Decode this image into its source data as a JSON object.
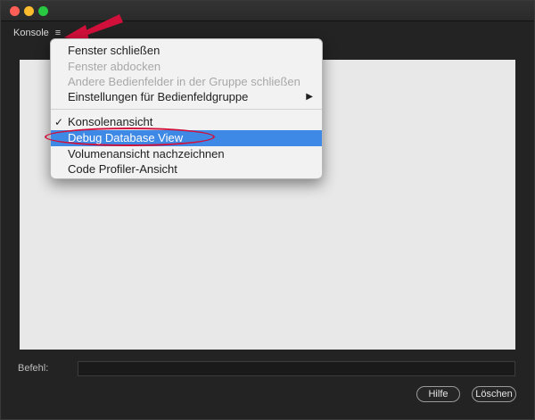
{
  "panel": {
    "title": "Konsole",
    "menu_icon": "hamburger-icon"
  },
  "menu": {
    "items": [
      {
        "label": "Fenster schließen"
      },
      {
        "label": "Fenster abdocken"
      },
      {
        "label": "Andere Bedienfelder in der Gruppe schließen"
      },
      {
        "label": "Einstellungen für Bedienfeldgruppe"
      },
      {
        "label": "Konsolenansicht"
      },
      {
        "label": "Debug Database View"
      },
      {
        "label": "Volumenansicht nachzeichnen"
      },
      {
        "label": "Code Profiler-Ansicht"
      }
    ],
    "submenu_arrow": "▶",
    "checkmark": "✓",
    "disabled_color": "#a8a8a8",
    "selected_color": "#3f89e6"
  },
  "command": {
    "label": "Befehl:",
    "value": ""
  },
  "buttons": {
    "help": "Hilfe",
    "delete": "Löschen"
  },
  "annotations": {
    "arrow_color": "#d0103a",
    "ellipse_color": "#d0103a"
  }
}
